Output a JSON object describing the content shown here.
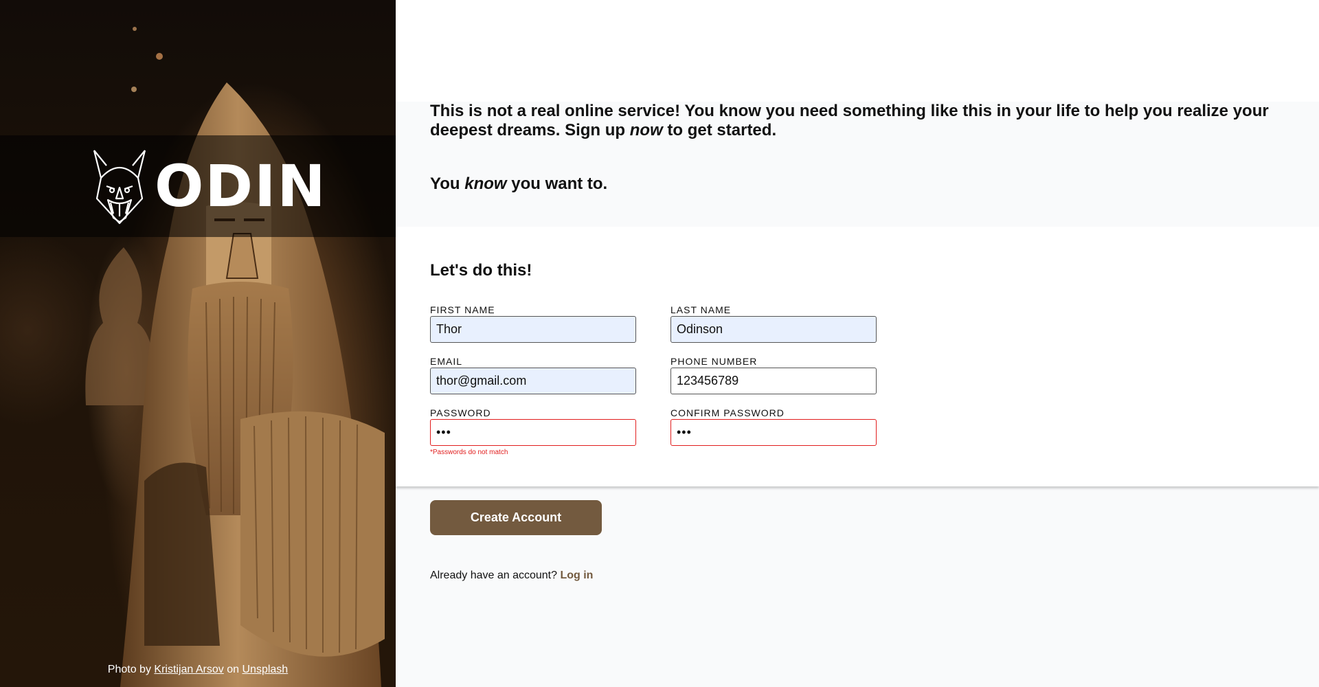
{
  "brand": {
    "name": "ODIN",
    "logo_icon": "viking-helmet-icon"
  },
  "credit": {
    "prefix": "Photo by",
    "author": "Kristijan Arsov",
    "middle": "on",
    "site": "Unsplash"
  },
  "intro": {
    "line1_a": "This is not a real online service! You know you need something like this in your life to help you realize your deepest dreams. Sign up",
    "line1_em": "now",
    "line1_b": "to get started.",
    "line2_a": "You",
    "line2_em": "know",
    "line2_b": "you want to."
  },
  "form": {
    "title": "Let's do this!",
    "first_name": {
      "label": "FIRST NAME",
      "value": "Thor"
    },
    "last_name": {
      "label": "LAST NAME",
      "value": "Odinson"
    },
    "email": {
      "label": "EMAIL",
      "value": "thor@gmail.com"
    },
    "phone": {
      "label": "PHONE NUMBER",
      "value": "123456789"
    },
    "password": {
      "label": "PASSWORD",
      "value": "•••",
      "error": "*Passwords do not match"
    },
    "confirm_password": {
      "label": "CONFIRM PASSWORD",
      "value": "•••"
    }
  },
  "actions": {
    "submit_label": "Create Account",
    "login_prompt": "Already have an account?",
    "login_link": "Log in"
  },
  "colors": {
    "accent": "#735a3f",
    "error": "#e11d1d",
    "autofill": "#e8f0fe"
  }
}
